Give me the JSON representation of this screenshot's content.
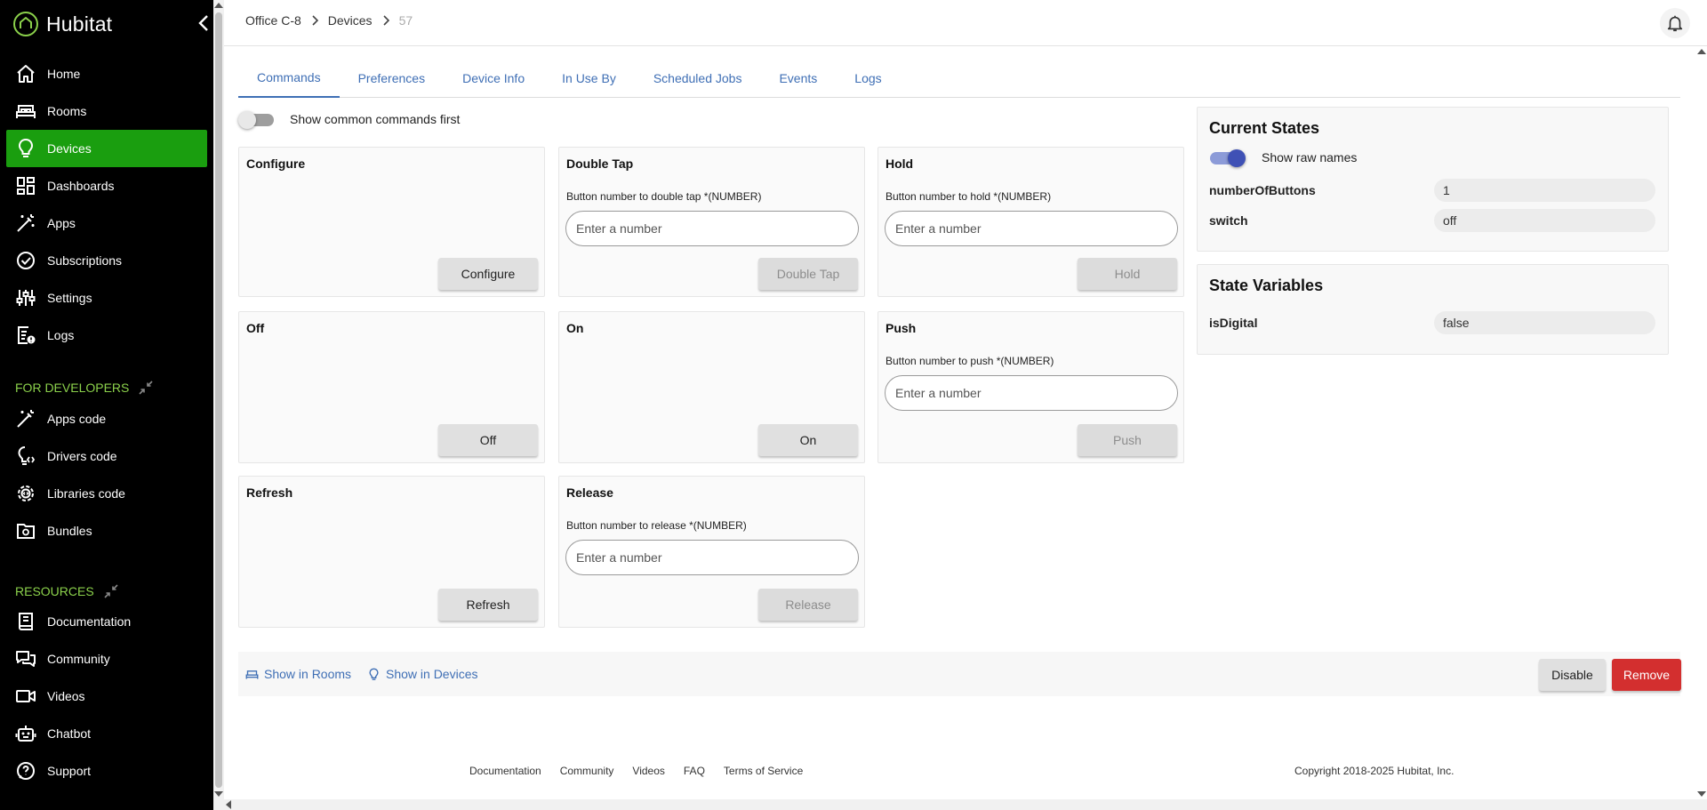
{
  "app": {
    "name": "Hubitat",
    "brand_color": "#1a9e0f",
    "accent_color": "#3f6fb5"
  },
  "sidebar": {
    "collapse_icon": "chevron-left-icon",
    "items": [
      {
        "label": "Home",
        "icon": "home-icon"
      },
      {
        "label": "Rooms",
        "icon": "bed-icon"
      },
      {
        "label": "Devices",
        "icon": "lightbulb-icon",
        "active": true
      },
      {
        "label": "Dashboards",
        "icon": "dashboard-icon"
      },
      {
        "label": "Apps",
        "icon": "magic-wand-icon"
      },
      {
        "label": "Subscriptions",
        "icon": "check-circle-icon"
      },
      {
        "label": "Settings",
        "icon": "sliders-icon"
      },
      {
        "label": "Logs",
        "icon": "log-icon"
      }
    ],
    "developers": {
      "header": "FOR DEVELOPERS",
      "items": [
        {
          "label": "Apps code",
          "icon": "code-wand-icon"
        },
        {
          "label": "Drivers code",
          "icon": "code-bulb-icon"
        },
        {
          "label": "Libraries code",
          "icon": "gear-code-icon"
        },
        {
          "label": "Bundles",
          "icon": "folder-gear-icon"
        }
      ]
    },
    "resources": {
      "header": "RESOURCES",
      "items": [
        {
          "label": "Documentation",
          "icon": "book-icon"
        },
        {
          "label": "Community",
          "icon": "chat-icon"
        },
        {
          "label": "Videos",
          "icon": "video-icon"
        },
        {
          "label": "Chatbot",
          "icon": "robot-icon"
        },
        {
          "label": "Support",
          "icon": "help-icon"
        }
      ]
    }
  },
  "breadcrumb": {
    "hub": "Office C-8",
    "section": "Devices",
    "device_id": "57"
  },
  "tabs": [
    {
      "label": "Commands",
      "active": true
    },
    {
      "label": "Preferences"
    },
    {
      "label": "Device Info"
    },
    {
      "label": "In Use By"
    },
    {
      "label": "Scheduled Jobs"
    },
    {
      "label": "Events"
    },
    {
      "label": "Logs"
    }
  ],
  "commands": {
    "toggle_label": "Show common commands first",
    "toggle_on": false,
    "cards": [
      {
        "title": "Configure",
        "button": "Configure",
        "disabled": false
      },
      {
        "title": "Double Tap",
        "param": "Button number to double tap *(NUMBER)",
        "placeholder": "Enter a number",
        "button": "Double Tap",
        "disabled": true
      },
      {
        "title": "Hold",
        "param": "Button number to hold *(NUMBER)",
        "placeholder": "Enter a number",
        "button": "Hold",
        "disabled": true
      },
      {
        "title": "Off",
        "button": "Off",
        "disabled": false
      },
      {
        "title": "On",
        "button": "On",
        "disabled": false
      },
      {
        "title": "Push",
        "param": "Button number to push *(NUMBER)",
        "placeholder": "Enter a number",
        "button": "Push",
        "disabled": true
      },
      {
        "title": "Refresh",
        "button": "Refresh",
        "disabled": false
      },
      {
        "title": "Release",
        "param": "Button number to release *(NUMBER)",
        "placeholder": "Enter a number",
        "button": "Release",
        "disabled": true
      }
    ]
  },
  "current_states": {
    "title": "Current States",
    "raw_names_label": "Show raw names",
    "raw_names_on": true,
    "rows": [
      {
        "name": "numberOfButtons",
        "value": "1"
      },
      {
        "name": "switch",
        "value": "off"
      }
    ]
  },
  "state_variables": {
    "title": "State Variables",
    "rows": [
      {
        "name": "isDigital",
        "value": "false"
      }
    ]
  },
  "actions": {
    "show_in_rooms": "Show in Rooms",
    "show_in_devices": "Show in Devices",
    "disable": "Disable",
    "remove": "Remove"
  },
  "footer": {
    "links": [
      "Documentation",
      "Community",
      "Videos",
      "FAQ",
      "Terms of Service"
    ],
    "copyright": "Copyright 2018-2025 Hubitat, Inc."
  }
}
